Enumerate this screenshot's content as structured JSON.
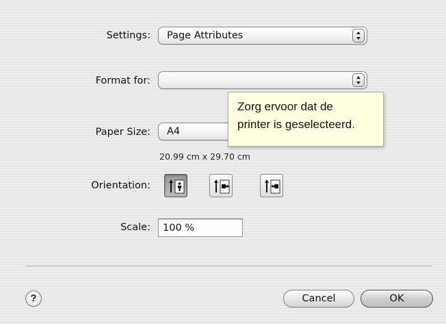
{
  "settings": {
    "label": "Settings:",
    "value": "Page Attributes"
  },
  "format_for": {
    "label": "Format for:",
    "value": ""
  },
  "paper_size": {
    "label": "Paper Size:",
    "value": "A4",
    "dimensions": "20.99 cm x 29.70 cm"
  },
  "orientation": {
    "label": "Orientation:",
    "options": [
      "portrait-icon",
      "landscape-left-icon",
      "landscape-right-icon"
    ],
    "selected_index": 0
  },
  "scale": {
    "label": "Scale:",
    "value": "100 %"
  },
  "tooltip": {
    "line1": "Zorg ervoor dat de",
    "line2": "printer is geselecteerd."
  },
  "footer": {
    "help_label": "?",
    "cancel_label": "Cancel",
    "ok_label": "OK"
  }
}
